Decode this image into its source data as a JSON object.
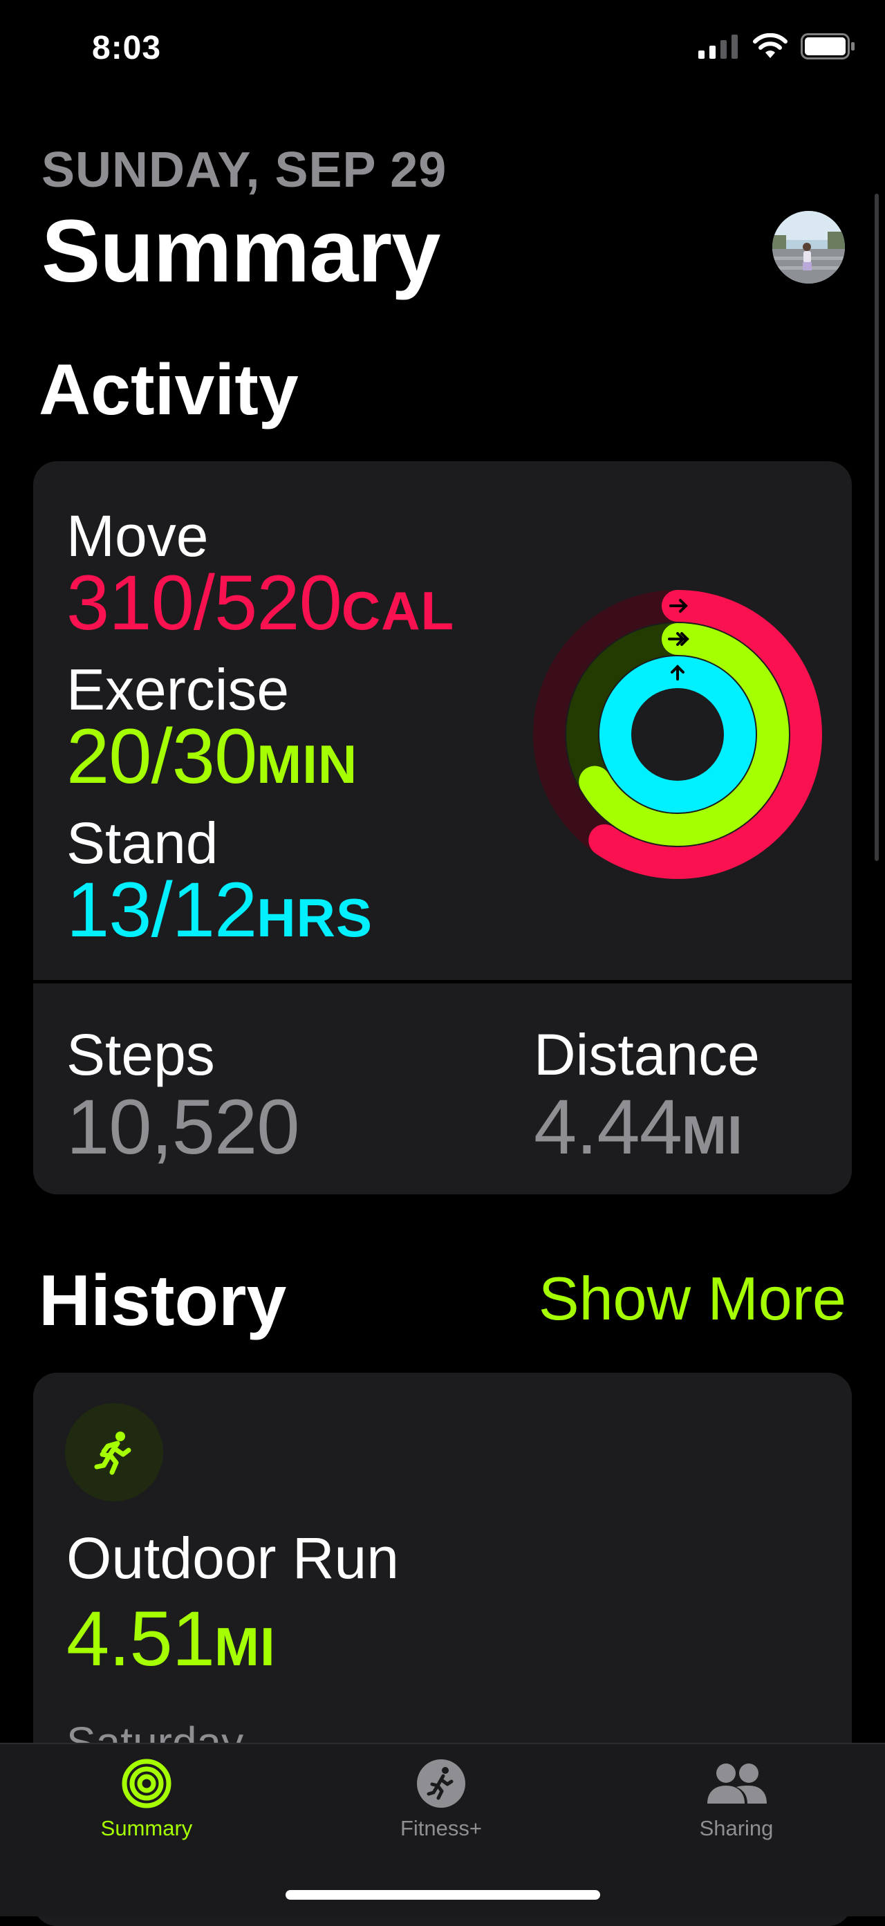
{
  "status_bar": {
    "time": "8:03"
  },
  "header": {
    "date": "SUNDAY, SEP 29",
    "title": "Summary"
  },
  "activity": {
    "heading": "Activity",
    "move": {
      "label": "Move",
      "value": "310/520",
      "unit": "CAL",
      "progress": 0.596,
      "color": "#fa114f"
    },
    "exercise": {
      "label": "Exercise",
      "value": "20/30",
      "unit": "MIN",
      "progress": 0.667,
      "color": "#a6ff00"
    },
    "stand": {
      "label": "Stand",
      "value": "13/12",
      "unit": "HRS",
      "progress": 1.083,
      "color": "#00f0ff"
    },
    "steps": {
      "label": "Steps",
      "value": "10,520"
    },
    "distance": {
      "label": "Distance",
      "value": "4.44",
      "unit": "MI"
    }
  },
  "history": {
    "heading": "History",
    "show_more": "Show More",
    "workout": {
      "name": "Outdoor Run",
      "value": "4.51",
      "unit": "MI",
      "day": "Saturday",
      "icon": "running-figure-icon"
    }
  },
  "tabs": [
    {
      "label": "Summary",
      "icon": "activity-rings-icon",
      "active": true
    },
    {
      "label": "Fitness+",
      "icon": "fitness-plus-icon",
      "active": false
    },
    {
      "label": "Sharing",
      "icon": "sharing-people-icon",
      "active": false
    }
  ],
  "colors": {
    "accent": "#a6ff00",
    "move": "#fa114f",
    "exercise": "#a6ff00",
    "stand": "#00f0ff",
    "inactive": "#8e8e93"
  }
}
